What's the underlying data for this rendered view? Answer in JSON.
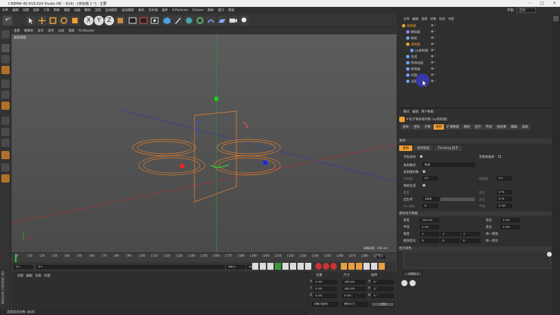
{
  "window": {
    "title": "CINEMA 4D R19.024 Studio (RC - R19) - [未标题 1 *] - 主要"
  },
  "menubar": [
    "文件",
    "编辑",
    "创建",
    "选择",
    "工具",
    "网格",
    "捕捉",
    "动画",
    "模拟",
    "渲染",
    "运动图形",
    "运动跟踪",
    "角色",
    "流水线",
    "插件",
    "X-Particles",
    "Octane",
    "脚本",
    "窗口",
    "帮助"
  ],
  "menubar_right": {
    "layout_label": "界面:",
    "layout_value": "启动"
  },
  "viewport": {
    "menu": [
      "查看",
      "摄像机",
      "显示",
      "选项",
      "过滤",
      "面板",
      "ProRender"
    ],
    "label": "透视视图",
    "grid_info": "网格间距 : 100 cm"
  },
  "timeline": {
    "ticks": [
      "0",
      "10",
      "20",
      "30",
      "40",
      "50",
      "60",
      "70",
      "80",
      "90",
      "100",
      "110",
      "120",
      "130",
      "140",
      "150",
      "160",
      "170",
      "180",
      "190",
      "200",
      "210",
      "220",
      "230",
      "240",
      "250",
      "260",
      "270",
      "280",
      "290"
    ],
    "current_frame": "0 F"
  },
  "transport": {
    "start": "0 F",
    "current": "0 F",
    "end": "300 F",
    "end2": "300 F"
  },
  "material_panel": {
    "tabs": [
      "创建",
      "编辑",
      "功能",
      "纹理"
    ]
  },
  "coord_panel": {
    "headers": [
      "位置",
      "尺寸",
      "旋转"
    ],
    "rows": [
      {
        "axis": "X",
        "pos": "0 cm",
        "size": "100 cm",
        "rot_axis": "H",
        "rot": "0 °"
      },
      {
        "axis": "Y",
        "pos": "0 cm",
        "size": "100 cm",
        "rot_axis": "P",
        "rot": "0 °"
      },
      {
        "axis": "Z",
        "pos": "0 cm",
        "size": "0 cm",
        "rot_axis": "B",
        "rot": "0 °"
      }
    ],
    "mode": "对象 (相对)",
    "size_mode": "绝对尺寸",
    "apply": "应用"
  },
  "object_manager": {
    "menu": [
      "文件",
      "编辑",
      "查看",
      "对象",
      "标签",
      "书签"
    ],
    "objects": [
      {
        "name": "发射器",
        "color": "#f0a030",
        "indent": 0
      },
      {
        "name": "模拟器",
        "color": "#8888ff",
        "indent": 1
      },
      {
        "name": "群组",
        "color": "#66aaff",
        "indent": 1
      },
      {
        "name": "发射器",
        "color": "#f0a030",
        "indent": 1
      },
      {
        "name": "xp发射器",
        "color": "#66aaff",
        "indent": 2
      },
      {
        "name": "生成",
        "color": "#66aaff",
        "indent": 1
      },
      {
        "name": "风场动画",
        "color": "#66aaff",
        "indent": 1
      },
      {
        "name": "修改器",
        "color": "#66aaff",
        "indent": 1
      },
      {
        "name": "问题",
        "color": "#66aaff",
        "indent": 1
      },
      {
        "name": "渲染",
        "color": "#66aaff",
        "indent": 1
      }
    ]
  },
  "attribute_manager": {
    "menu": [
      "模式",
      "编辑",
      "用户数据"
    ],
    "object_title": "X-粒子发射器对象 [xp发射器]",
    "tabs": [
      "基本",
      "坐标",
      "对象",
      "发射",
      "扩展数据",
      "群组",
      "显示",
      "传递",
      "相关事",
      "编辑",
      "高级"
    ],
    "active_tab": "发射",
    "section_title": "发射",
    "subtabs": [
      "发射",
      "发射速度",
      "Thinking 粒子"
    ],
    "fields": {
      "born_label": "子粒发射",
      "emit_mode_label": "发射模式",
      "emit_mode_value": "批量",
      "emit_rand_label": "发射随机数",
      "start_frame_label": "开始帧",
      "start_frame_value": "0 F",
      "end_frame_label": "结束帧",
      "end_frame_value": "0 F",
      "birth_label": "每帧生成",
      "rate_label": "数量",
      "rate_value": "1000",
      "rate_var_label": "变化",
      "rate_var_value": "0 %",
      "birth2_label": "出生率",
      "birth2_value": "1000",
      "no_inherit_label": "No 发射",
      "no_inherit_value": "0",
      "loop_label": "无限制发射",
      "half_label": "半径",
      "half_value": "0 cm"
    },
    "particle_section": "基本粒子数据",
    "particle_fields": [
      {
        "label": "速度",
        "value": "150 cm",
        "var_label": "变化",
        "var_value": "0 cm"
      },
      {
        "label": "半径",
        "value": "2 cm",
        "var_label": "变化",
        "var_value": "0 cm"
      },
      {
        "label": "缩放",
        "value": "1",
        "value2": "1",
        "value3": "1",
        "uni_label": "统一缩放"
      },
      {
        "label": "缩放变化",
        "value": "0",
        "value2": "0",
        "value3": "0",
        "uni_label": "统一变化"
      }
    ],
    "color_section": "粒子颜色",
    "color_label": "颜色",
    "add_button": "添加粒子",
    "color_mode": "颜色"
  },
  "status_bar": {
    "text": "选取您的对象 (关闭)"
  },
  "branding": {
    "line1": "MAXON",
    "line2": "CINEMA 4D"
  }
}
